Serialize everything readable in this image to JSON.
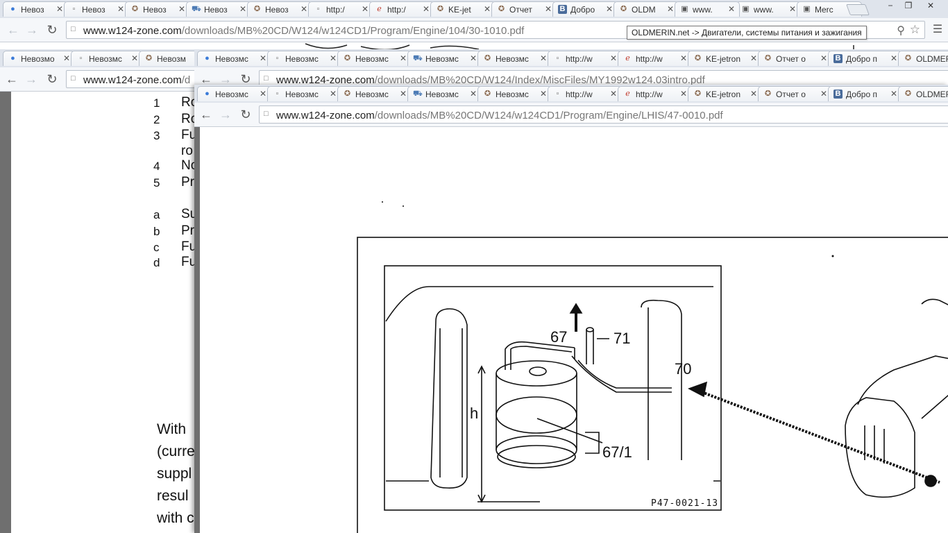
{
  "window_controls": {
    "minimize": "−",
    "restore": "❐",
    "close": "✕"
  },
  "win1": {
    "tabs": [
      {
        "label": "Невоз",
        "icon": "chrome-icon"
      },
      {
        "label": "Невоз",
        "icon": "page-icon"
      },
      {
        "label": "Невоз",
        "icon": "mercedes-icon"
      },
      {
        "label": "Невоз",
        "icon": "car-icon"
      },
      {
        "label": "Невоз",
        "icon": "mercedes-icon"
      },
      {
        "label": "http:/",
        "icon": "page-icon"
      },
      {
        "label": "http:/",
        "icon": "ie-icon"
      },
      {
        "label": "KE-jet",
        "icon": "mercedes-icon"
      },
      {
        "label": "Отчет",
        "icon": "mercedes-icon"
      },
      {
        "label": "Добро",
        "icon": "vk-icon"
      },
      {
        "label": "OLDM",
        "icon": "mercedes-icon"
      },
      {
        "label": "www.",
        "icon": "avatar-icon"
      },
      {
        "label": "www.",
        "icon": "avatar-icon"
      },
      {
        "label": "Merc",
        "icon": "avatar-icon"
      }
    ],
    "url_host": "www.w124-zone.com",
    "url_path": "/downloads/MB%20CD/W124/w124CD1/Program/Engine/104/30-1010.pdf",
    "tooltip": "OLDMERIN.net -> Двигатели, системы питания и зажигания"
  },
  "win2": {
    "tabs": [
      {
        "label": "Невозмо",
        "icon": "chrome-icon"
      },
      {
        "label": "Невозмс",
        "icon": "page-icon"
      },
      {
        "label": "Невозм",
        "icon": "mercedes-icon"
      }
    ],
    "url_host": "www.w124-zone.com",
    "url_path": "/d",
    "list": [
      {
        "num": "1",
        "text": "Ro"
      },
      {
        "num": "2",
        "text": "Ro"
      },
      {
        "num": "3",
        "text": "Fu"
      },
      {
        "num": "",
        "text": "ro"
      },
      {
        "num": "4",
        "text": "No"
      },
      {
        "num": "5",
        "text": "Pr"
      },
      {
        "num": "a",
        "text": "Su"
      },
      {
        "num": "b",
        "text": "Pr"
      },
      {
        "num": "c",
        "text": "Fu"
      },
      {
        "num": "d",
        "text": "Fu"
      }
    ],
    "paragraph": [
      "With",
      "(curre",
      "suppl",
      "resul",
      "with c"
    ]
  },
  "win3": {
    "tabs": [
      {
        "label": "Невозмс",
        "icon": "chrome-icon"
      },
      {
        "label": "Невозмс",
        "icon": "page-icon"
      },
      {
        "label": "Невозмс",
        "icon": "mercedes-icon"
      },
      {
        "label": "Невозмс",
        "icon": "car-icon"
      },
      {
        "label": "Невозмс",
        "icon": "mercedes-icon"
      },
      {
        "label": "http://w",
        "icon": "page-icon"
      },
      {
        "label": "http://w",
        "icon": "ie-icon"
      },
      {
        "label": "KE-jetron",
        "icon": "mercedes-icon"
      },
      {
        "label": "Отчет о",
        "icon": "mercedes-icon"
      },
      {
        "label": "Добро п",
        "icon": "vk-icon"
      },
      {
        "label": "OLDMER",
        "icon": "mercedes-icon"
      }
    ],
    "url_host": "www.w124-zone.com",
    "url_path": "/downloads/MB%20CD/W124/Index/MiscFiles/MY1992w124.03intro.pdf"
  },
  "win4": {
    "tabs": [
      {
        "label": "Невозмс",
        "icon": "chrome-icon"
      },
      {
        "label": "Невозмс",
        "icon": "page-icon"
      },
      {
        "label": "Невозмс",
        "icon": "mercedes-icon"
      },
      {
        "label": "Невозмс",
        "icon": "car-icon"
      },
      {
        "label": "Невозмс",
        "icon": "mercedes-icon"
      },
      {
        "label": "http://w",
        "icon": "page-icon"
      },
      {
        "label": "http://w",
        "icon": "ie-icon"
      },
      {
        "label": "KE-jetron",
        "icon": "mercedes-icon"
      },
      {
        "label": "Отчет о",
        "icon": "mercedes-icon"
      },
      {
        "label": "Добро п",
        "icon": "vk-icon"
      },
      {
        "label": "OLDMER",
        "icon": "mercedes-icon"
      }
    ],
    "url_host": "www.w124-zone.com",
    "url_path": "/downloads/MB%20CD/W124/w124CD1/Program/Engine/LHIS/47-0010.pdf",
    "diagram": {
      "callouts": [
        "67",
        "71",
        "70",
        "h",
        "67/1"
      ],
      "caption": "P47-0021-13"
    }
  }
}
